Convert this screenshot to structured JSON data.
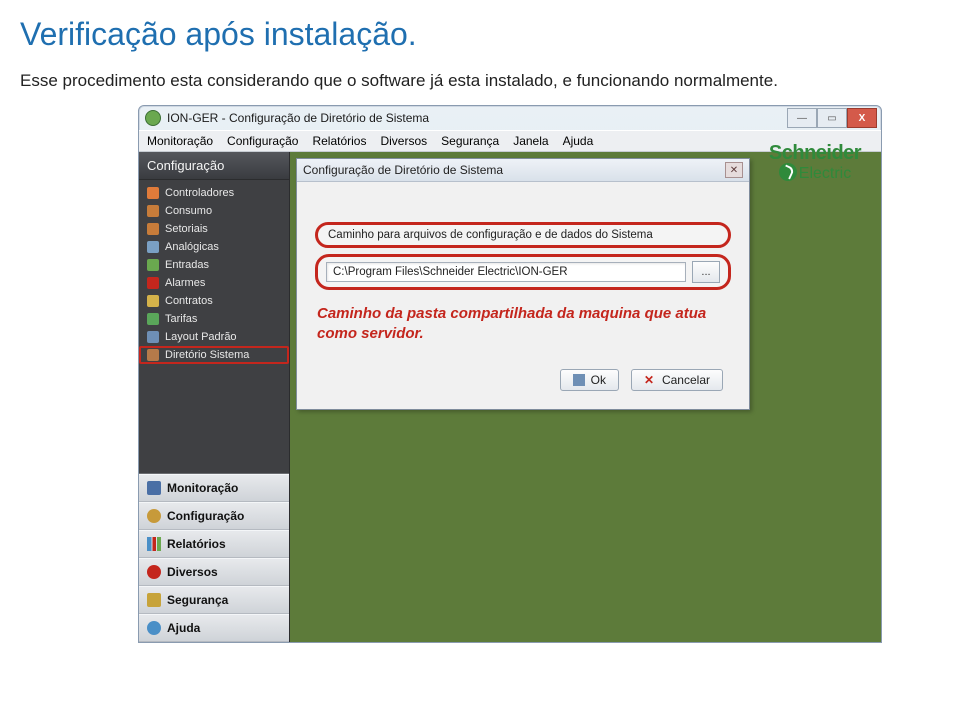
{
  "page": {
    "heading": "Verificação após instalação.",
    "subtext": "Esse procedimento esta considerando que o software já esta instalado, e funcionando normalmente."
  },
  "window": {
    "title": "ION-GER - Configuração de Diretório de Sistema",
    "win_buttons": {
      "min": "—",
      "max": "▭",
      "close": "X"
    }
  },
  "menubar": {
    "items": [
      "Monitoração",
      "Configuração",
      "Relatórios",
      "Diversos",
      "Segurança",
      "Janela",
      "Ajuda"
    ]
  },
  "sidebar": {
    "title": "Configuração",
    "items": [
      {
        "label": "Controladores",
        "color": "#e07b3a"
      },
      {
        "label": "Consumo",
        "color": "#c77c3a"
      },
      {
        "label": "Setoriais",
        "color": "#c77c3a"
      },
      {
        "label": "Analógicas",
        "color": "#7aa0c4"
      },
      {
        "label": "Entradas",
        "color": "#6aa84f"
      },
      {
        "label": "Alarmes",
        "color": "#c4261d"
      },
      {
        "label": "Contratos",
        "color": "#d4b24a"
      },
      {
        "label": "Tarifas",
        "color": "#5aa65a"
      },
      {
        "label": "Layout Padrão",
        "color": "#6e8fb5"
      },
      {
        "label": "Diretório Sistema",
        "color": "#b57a4a",
        "highlight": true
      }
    ],
    "nav": [
      {
        "label": "Monitoração",
        "icon": "#4a6fa5"
      },
      {
        "label": "Configuração",
        "icon": "#c79a3a"
      },
      {
        "label": "Relatórios",
        "icon": "#4a8fc7"
      },
      {
        "label": "Diversos",
        "icon": "#c4261d"
      },
      {
        "label": "Segurança",
        "icon": "#c7a33a"
      },
      {
        "label": "Ajuda",
        "icon": "#4a8fc7"
      }
    ]
  },
  "dialog": {
    "title": "Configuração de Diretório de Sistema",
    "close": "✕",
    "group_label": "Caminho para arquivos de configuração e de dados do Sistema",
    "path_value": "C:\\Program Files\\Schneider Electric\\ION-GER",
    "browse": "...",
    "annotation": "Caminho da pasta compartilhada da maquina que atua como servidor.",
    "ok": "Ok",
    "cancel": "Cancelar"
  },
  "brand": {
    "top": "Schneider",
    "bottom": "Electric"
  }
}
